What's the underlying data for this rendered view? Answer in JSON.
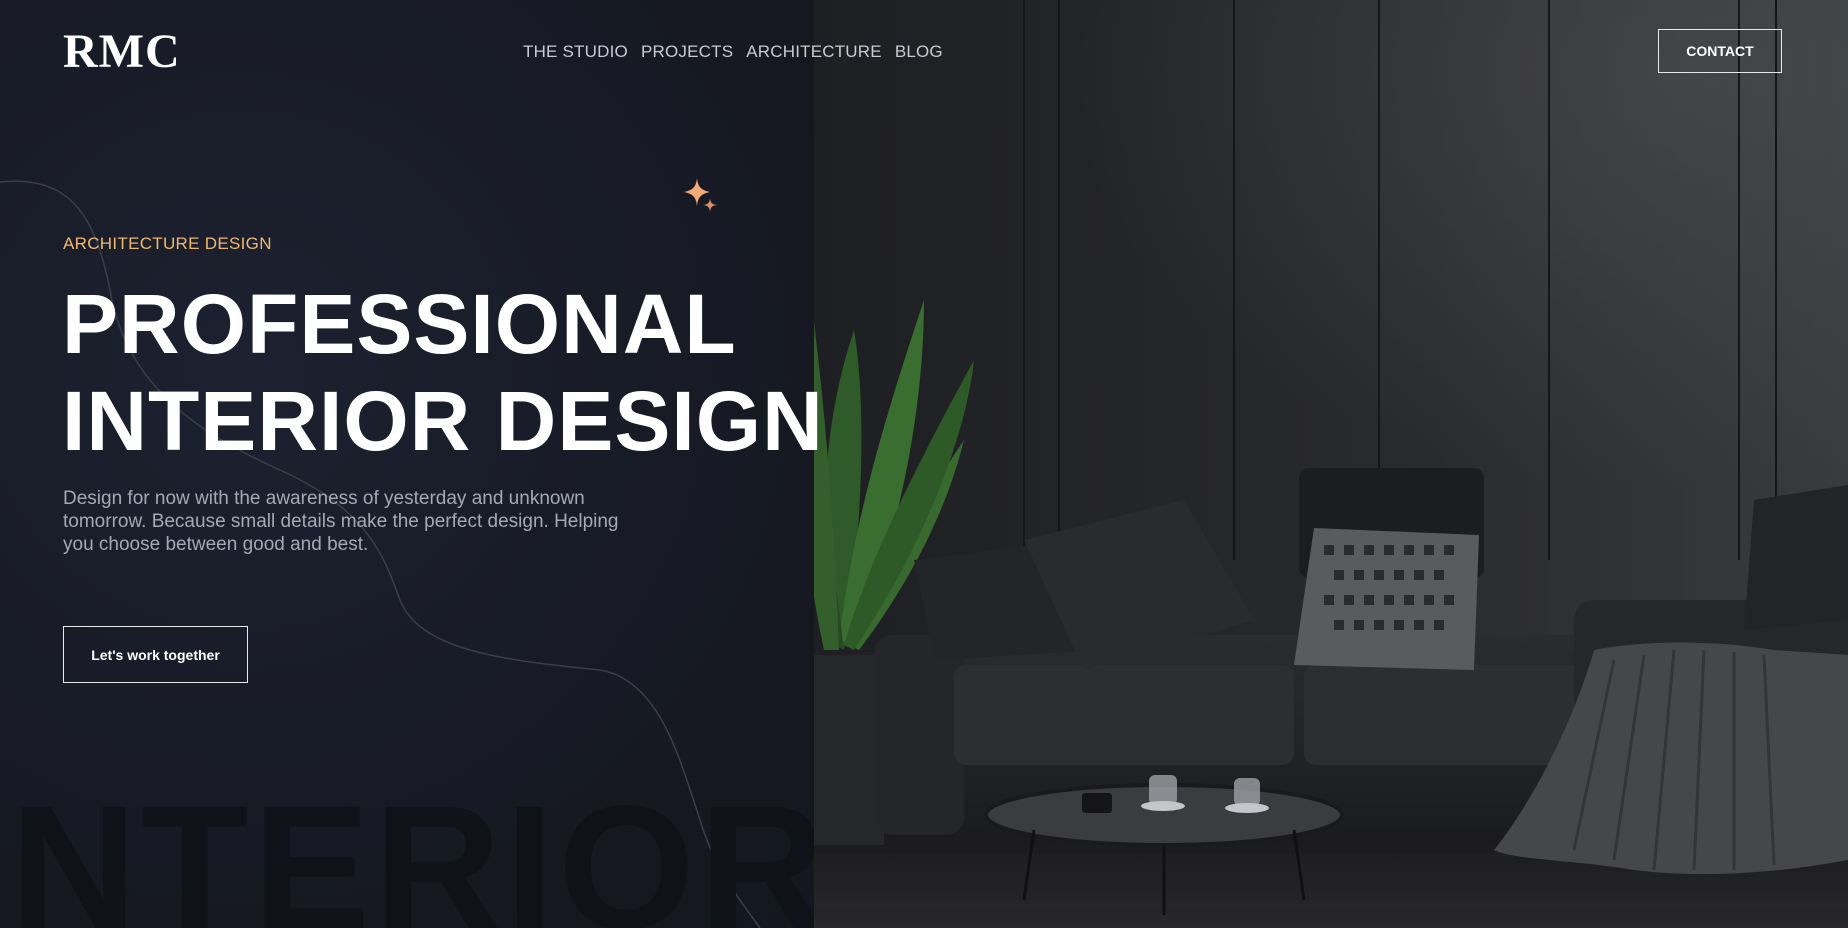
{
  "brand": {
    "logo": "RMC"
  },
  "nav": {
    "links": [
      "THE STUDIO",
      "PROJECTS",
      "ARCHITECTURE",
      "BLOG"
    ],
    "contact_label": "CONTACT"
  },
  "hero": {
    "eyebrow": "ARCHITECTURE DESIGN",
    "title_line1": "PROFESSIONAL",
    "title_line2": "INTERIOR DESIGN",
    "description": "Design for now with the awareness of yesterday and unknown tomorrow. Because small details make the perfect design. Helping you choose between good and best.",
    "cta_label": "Let's work together",
    "background_word": "NTERIOR"
  },
  "icons": {
    "sparkle": "sparkle-icon"
  },
  "colors": {
    "background": "#181b24",
    "accent": "#f0b86c",
    "sparkle": "#f3a978",
    "text": "#ffffff",
    "muted_text": "#a5a9b3"
  }
}
